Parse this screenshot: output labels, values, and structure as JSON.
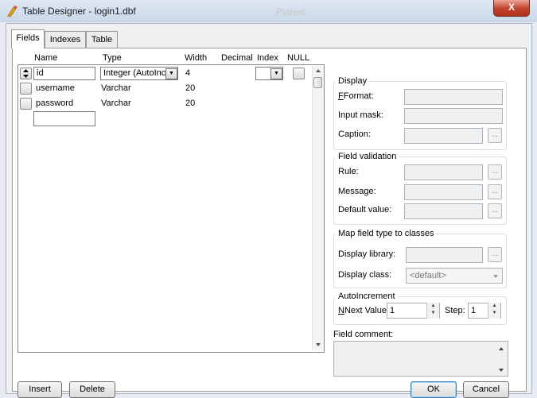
{
  "window": {
    "title": "Table Designer - login1.dbf",
    "background_title": "Planes",
    "close_glyph": "X"
  },
  "tabs": [
    {
      "label": "Fields"
    },
    {
      "label": "Indexes"
    },
    {
      "label": "Table"
    }
  ],
  "grid": {
    "columns": [
      "Name",
      "Type",
      "Width",
      "Decimal",
      "Index",
      "NULL"
    ],
    "rows": [
      {
        "name": "id",
        "type": "Integer (AutoInc",
        "width": "4"
      },
      {
        "name": "username",
        "type": "Varchar",
        "width": "20"
      },
      {
        "name": "password",
        "type": "Varchar",
        "width": "20"
      }
    ],
    "new_row_name": ""
  },
  "display": {
    "title": "Display",
    "format_label": "Format:",
    "input_mask_label": "Input mask:",
    "caption_label": "Caption:"
  },
  "validation": {
    "title": "Field validation",
    "rule_label": "Rule:",
    "message_label": "Message:",
    "default_label": "Default value:"
  },
  "mapping": {
    "title": "Map field type to classes",
    "library_label": "Display library:",
    "class_label": "Display class:",
    "class_value": "<default>"
  },
  "autoincrement": {
    "title": "AutoIncrement",
    "next_value_label": "Next Value:",
    "next_value": "1",
    "step_label": "Step:",
    "step": "1"
  },
  "comment": {
    "label": "Field comment:"
  },
  "buttons": {
    "insert": "Insert",
    "delete": "Delete",
    "ok": "OK",
    "cancel": "Cancel",
    "ellipsis": "..."
  },
  "colors": {
    "close": "#c2412c",
    "accent": "#3c7fb1"
  }
}
